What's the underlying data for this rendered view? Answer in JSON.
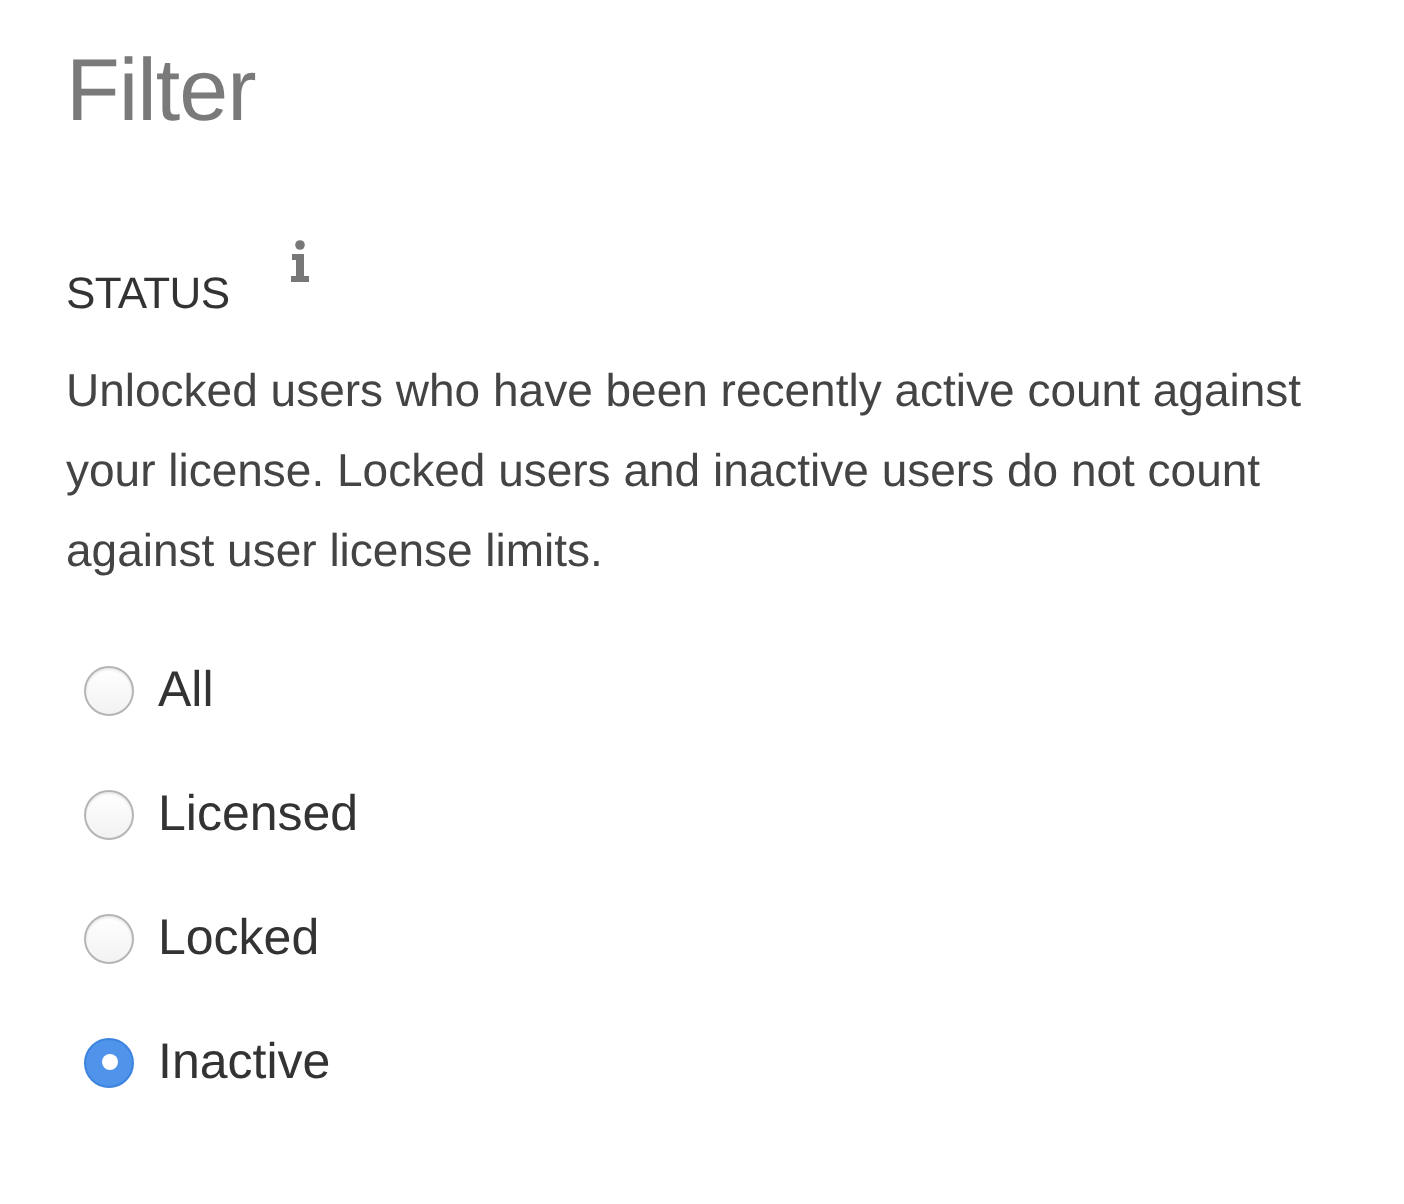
{
  "title": "Filter",
  "status": {
    "label": "STATUS",
    "description": "Unlocked users who have been recently active count against your license. Locked users and inactive users do not count against user license limits."
  },
  "options": [
    {
      "label": "All",
      "selected": false
    },
    {
      "label": "Licensed",
      "selected": false
    },
    {
      "label": "Locked",
      "selected": false
    },
    {
      "label": "Inactive",
      "selected": true
    }
  ]
}
